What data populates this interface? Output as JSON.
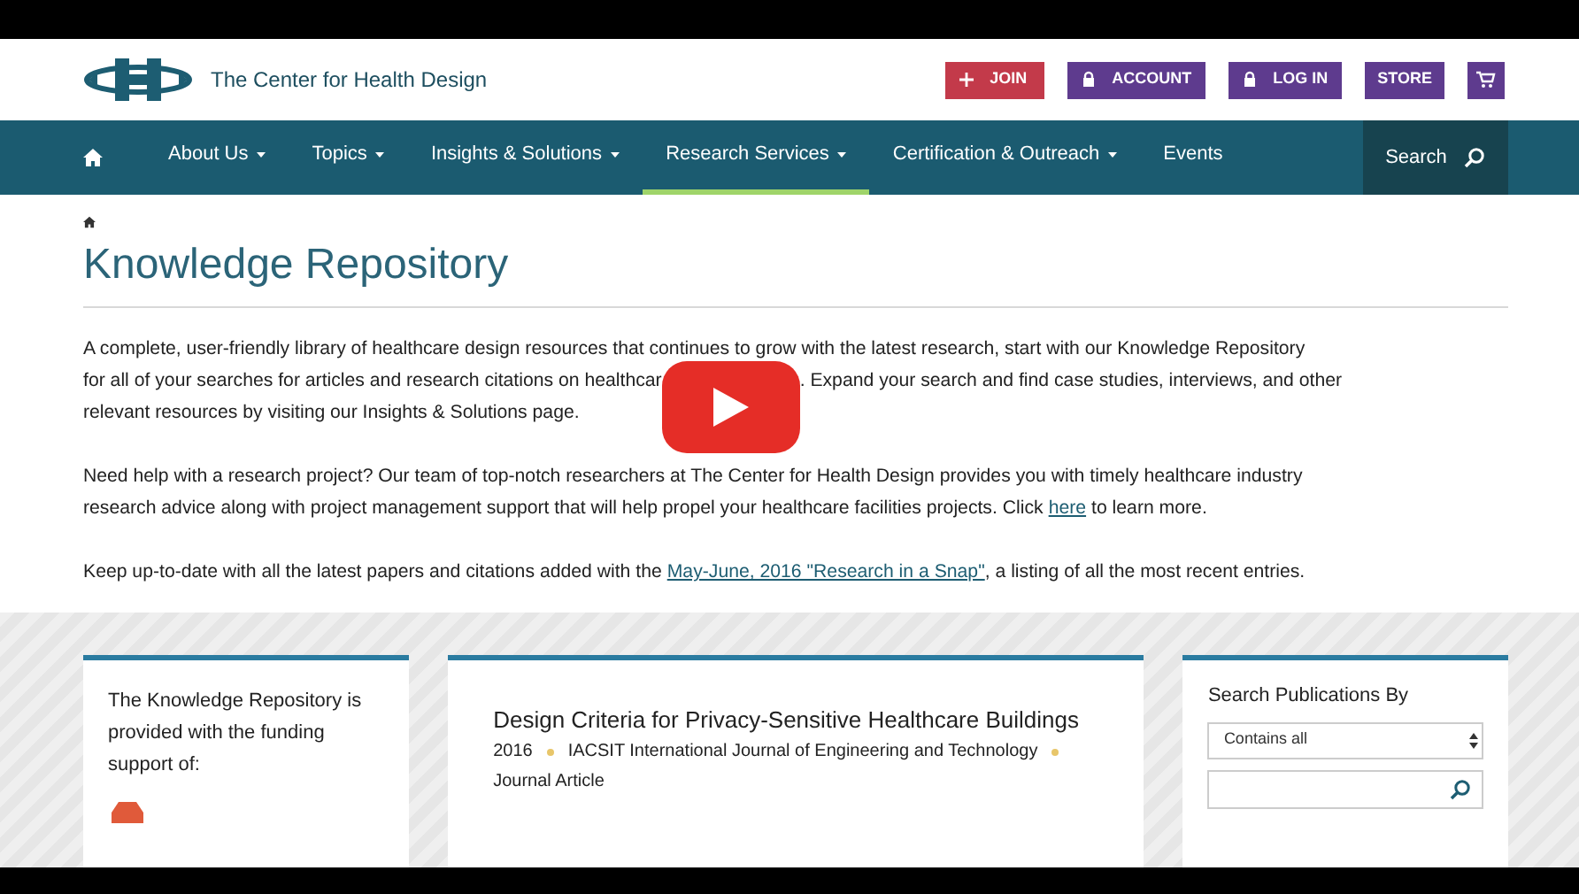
{
  "header": {
    "site_name": "The Center for Health Design",
    "buttons": [
      {
        "label": "JOIN",
        "kind": "join"
      },
      {
        "label": "ACCOUNT",
        "kind": "lock"
      },
      {
        "label": "LOG IN",
        "kind": "lock"
      },
      {
        "label": "STORE",
        "kind": "plain"
      },
      {
        "kind": "cart"
      }
    ]
  },
  "nav": {
    "items": [
      {
        "label": "About Us",
        "dropdown": true,
        "selected": false
      },
      {
        "label": "Topics",
        "dropdown": true,
        "selected": false
      },
      {
        "label": "Insights & Solutions",
        "dropdown": true,
        "selected": false
      },
      {
        "label": "Research Services",
        "dropdown": true,
        "selected": true
      },
      {
        "label": "Certification & Outreach",
        "dropdown": true,
        "selected": false
      },
      {
        "label": "Events",
        "dropdown": false,
        "selected": false
      }
    ],
    "search_label": "Search"
  },
  "page": {
    "title": "Knowledge Repository",
    "paragraph_1": {
      "line_1": "A complete, user-friendly library of healthcare design resources that continues to grow with the latest research, start with our Knowledge Repository",
      "line_2_before": "for all of your searches for articles and research citations on healthcar",
      "line_2_after": ". Expand your search and find case studies, interviews, and other",
      "line_3": "relevant resources by visiting our Insights & Solutions page."
    },
    "paragraph_2": {
      "line_1": "Need help with a research project?  Our team of top-notch researchers at The Center for Health Design provides you with timely healthcare industry",
      "before": "research advice along with project management support that will help propel your healthcare facilities projects. Click",
      "link": "here",
      "after": "to learn more."
    },
    "paragraph_3": {
      "before": "Keep up-to-date with all the latest papers and citations added with the",
      "link": "May-June, 2016 \"Research in a Snap\"",
      "after": ", a listing of all the most recent entries."
    }
  },
  "funding_card": {
    "text": "The Knowledge Repository is provided with the funding support of:"
  },
  "result_card": {
    "title": "Design Criteria for Privacy-Sensitive Healthcare Buildings",
    "meta": [
      "2016",
      "IACSIT International Journal of Engineering and Technology",
      "Journal Article"
    ]
  },
  "search_card": {
    "label": "Search Publications By",
    "select_value": "Contains all"
  }
}
